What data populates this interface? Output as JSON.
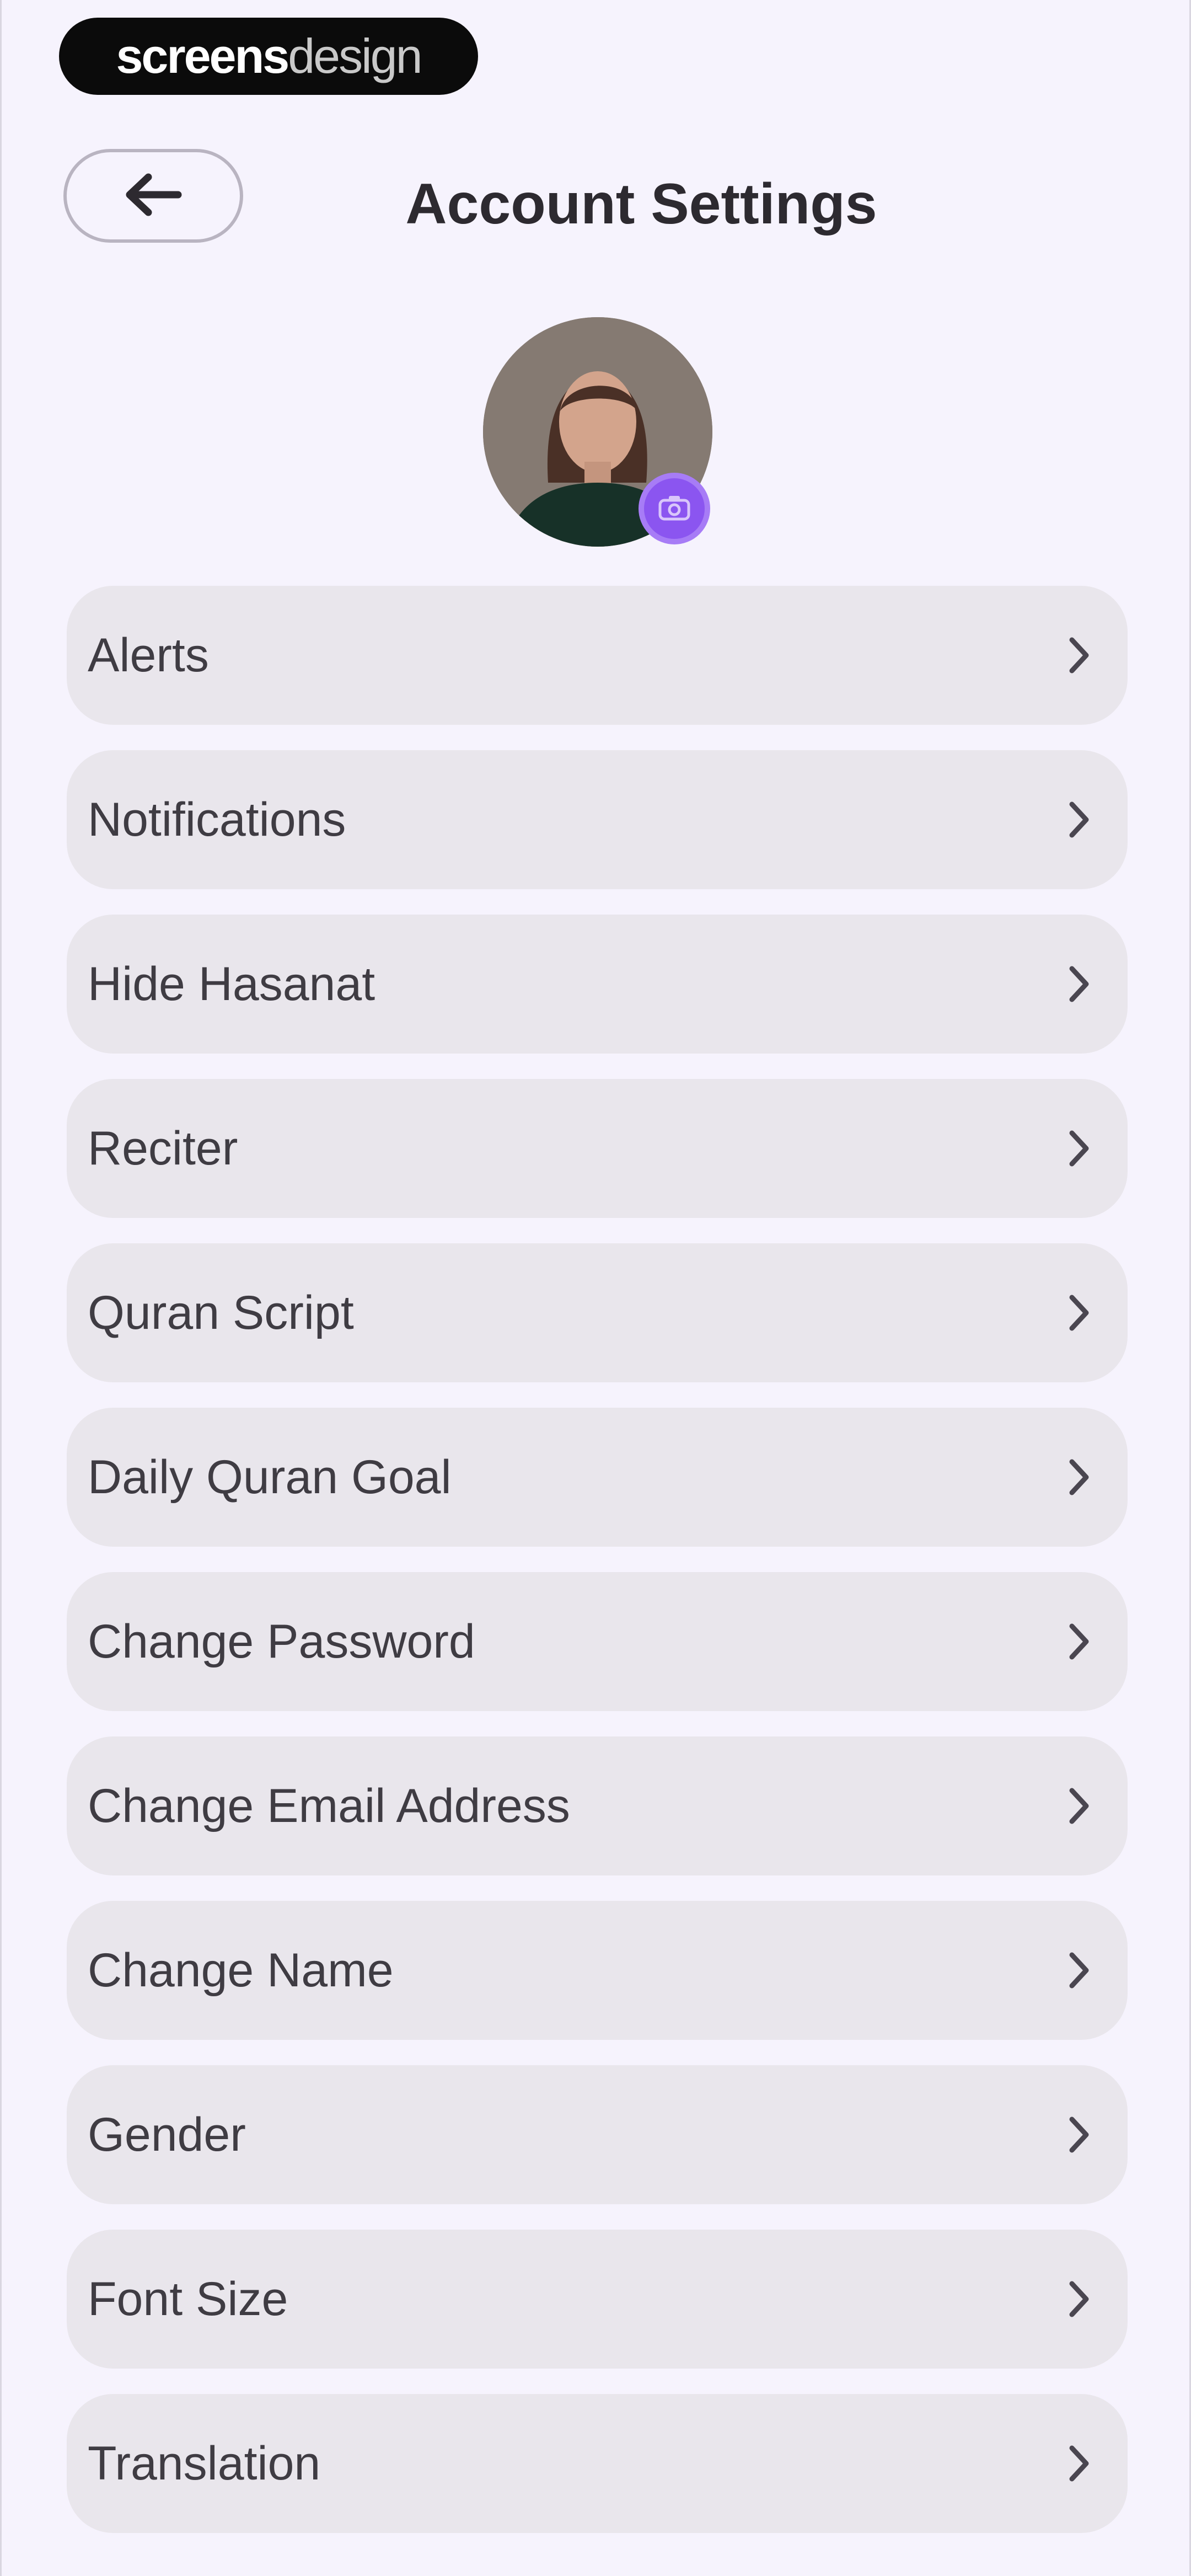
{
  "brand": {
    "bold": "screens",
    "light": "design"
  },
  "header": {
    "title": "Account Settings",
    "back_icon": "arrow-left-icon"
  },
  "profile": {
    "edit_icon": "camera-icon",
    "accent": "#8b55f0"
  },
  "settings": {
    "items": [
      {
        "label": "Alerts"
      },
      {
        "label": "Notifications"
      },
      {
        "label": "Hide Hasanat"
      },
      {
        "label": "Reciter"
      },
      {
        "label": "Quran Script"
      },
      {
        "label": "Daily Quran Goal"
      },
      {
        "label": "Change Password"
      },
      {
        "label": "Change Email Address"
      },
      {
        "label": "Change Name"
      },
      {
        "label": "Gender"
      },
      {
        "label": "Font Size"
      },
      {
        "label": "Translation"
      }
    ],
    "chevron_icon": "chevron-right-icon"
  }
}
